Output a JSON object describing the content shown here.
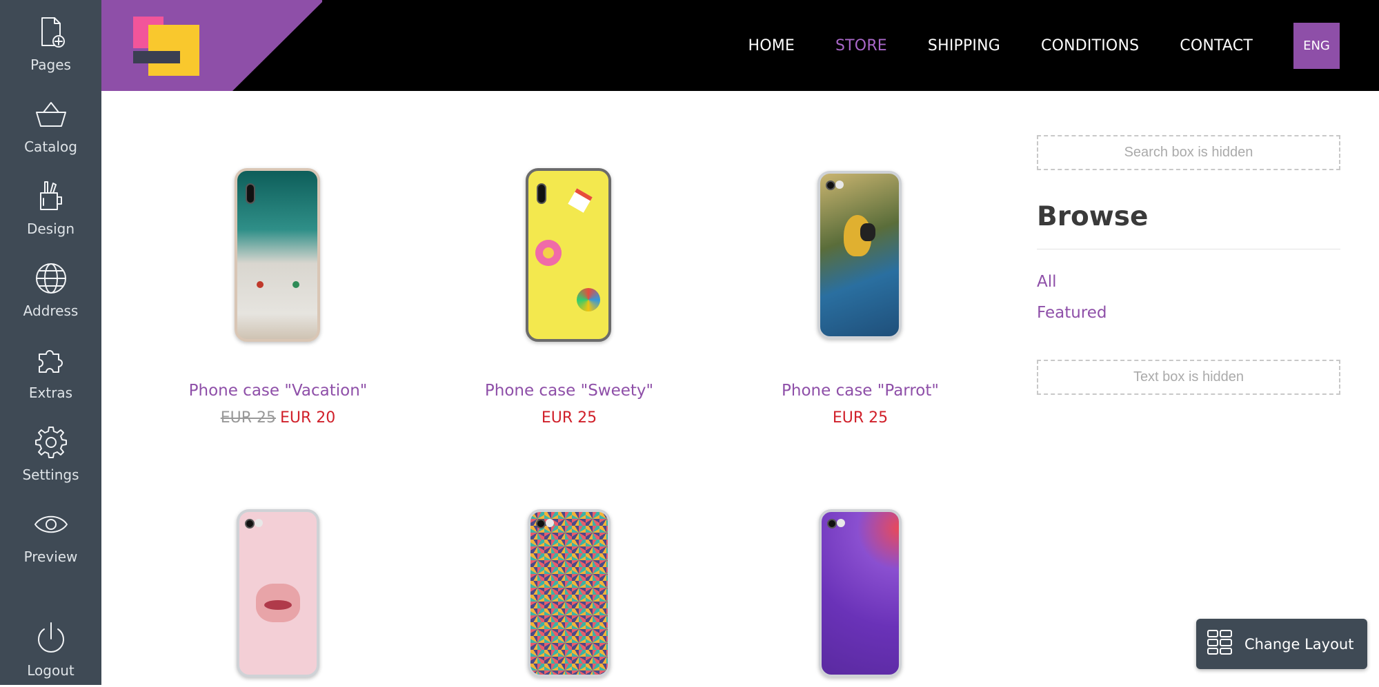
{
  "sidebar": {
    "items": [
      {
        "label": "Pages",
        "icon": "page-add-icon"
      },
      {
        "label": "Catalog",
        "icon": "basket-icon"
      },
      {
        "label": "Design",
        "icon": "design-tools-icon"
      },
      {
        "label": "Address",
        "icon": "globe-icon"
      },
      {
        "label": "Extras",
        "icon": "puzzle-icon"
      },
      {
        "label": "Settings",
        "icon": "gear-icon"
      },
      {
        "label": "Preview",
        "icon": "eye-icon"
      },
      {
        "label": "Logout",
        "icon": "power-icon"
      }
    ]
  },
  "header": {
    "nav": [
      "HOME",
      "STORE",
      "SHIPPING",
      "CONDITIONS",
      "CONTACT"
    ],
    "active": "STORE",
    "language": "ENG"
  },
  "products": [
    {
      "title": "Phone case \"Vacation\"",
      "old_price": "EUR 25",
      "price": "EUR 20"
    },
    {
      "title": "Phone case \"Sweety\"",
      "old_price": "",
      "price": "EUR 25"
    },
    {
      "title": "Phone case \"Parrot\"",
      "old_price": "",
      "price": "EUR 25"
    },
    {
      "title": "",
      "old_price": "",
      "price": ""
    },
    {
      "title": "",
      "old_price": "",
      "price": ""
    },
    {
      "title": "",
      "old_price": "",
      "price": ""
    }
  ],
  "right_sidebar": {
    "search_hidden": "Search box is hidden",
    "browse_title": "Browse",
    "links": [
      "All",
      "Featured"
    ],
    "text_hidden": "Text box is hidden"
  },
  "change_layout": "Change Layout",
  "colors": {
    "accent": "#8e4fa8",
    "sidebar_bg": "#3f4a55",
    "price": "#d0202a",
    "header_bg": "#000000"
  }
}
